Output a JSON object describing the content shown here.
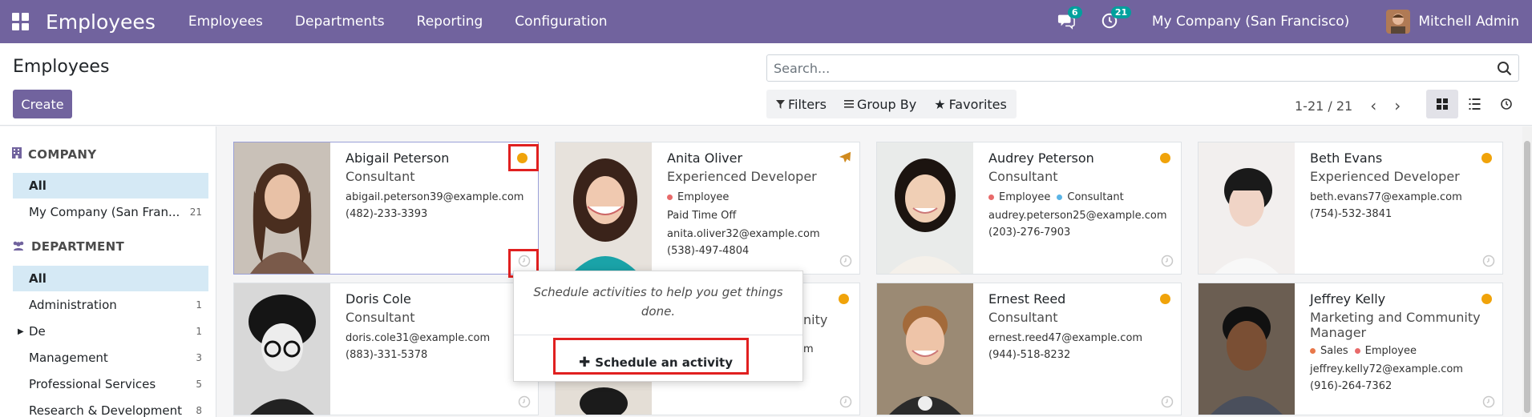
{
  "navbar": {
    "brand": "Employees",
    "menu": [
      "Employees",
      "Departments",
      "Reporting",
      "Configuration"
    ],
    "messages_count": "6",
    "activities_count": "21",
    "company": "My Company (San Francisco)",
    "user": "Mitchell Admin"
  },
  "control": {
    "title": "Employees",
    "create_label": "Create",
    "search_placeholder": "Search...",
    "filters_label": "Filters",
    "groupby_label": "Group By",
    "favorites_label": "Favorites",
    "pager": "1-21 / 21"
  },
  "sidebar": {
    "company_header": "COMPANY",
    "company_items": [
      {
        "label": "All",
        "count": ""
      },
      {
        "label": "My Company (San Fran...",
        "count": "21"
      }
    ],
    "department_header": "DEPARTMENT",
    "department_items": [
      {
        "label": "All",
        "count": ""
      },
      {
        "label": "Administration",
        "count": "1"
      },
      {
        "label": "De",
        "count": "1"
      },
      {
        "label": "Management",
        "count": "3"
      },
      {
        "label": "Professional Services",
        "count": "5"
      },
      {
        "label": "Research & Development",
        "count": "8"
      }
    ]
  },
  "employees": [
    {
      "name": "Abigail Peterson",
      "job": "Consultant",
      "email": "abigail.peterson39@example.com",
      "phone": "(482)-233-3393"
    },
    {
      "name": "Anita Oliver",
      "job": "Experienced Developer",
      "tags": [
        "Employee"
      ],
      "status_text": "Paid Time Off",
      "email": "anita.oliver32@example.com",
      "phone": "(538)-497-4804"
    },
    {
      "name": "Audrey Peterson",
      "job": "Consultant",
      "tags": [
        "Employee",
        "Consultant"
      ],
      "email": "audrey.peterson25@example.com",
      "phone": "(203)-276-7903"
    },
    {
      "name": "Beth Evans",
      "job": "Experienced Developer",
      "email": "beth.evans77@example.com",
      "phone": "(754)-532-3841"
    },
    {
      "name": "Doris Cole",
      "job": "Consultant",
      "email": "doris.cole31@example.com",
      "phone": "(883)-331-5378"
    },
    {
      "job_fragment": "nity",
      "email_fragment": "m"
    },
    {
      "name": "Ernest Reed",
      "job": "Consultant",
      "email": "ernest.reed47@example.com",
      "phone": "(944)-518-8232"
    },
    {
      "name": "Jeffrey Kelly",
      "job_line1": "Marketing and Community",
      "job_line2": "Manager",
      "tags": [
        "Sales",
        "Employee"
      ],
      "email": "jeffrey.kelly72@example.com",
      "phone": "(916)-264-7362"
    }
  ],
  "popover": {
    "text": "Schedule activities to help you get things done.",
    "button_label": "Schedule an activity"
  },
  "colors": {
    "navbar": "#71639e",
    "status_orange": "#f0a30a",
    "tag_employee": "#e86a6a",
    "tag_consultant": "#5ab4e6",
    "tag_sales": "#e8784a",
    "highlight_red": "#e02020"
  }
}
